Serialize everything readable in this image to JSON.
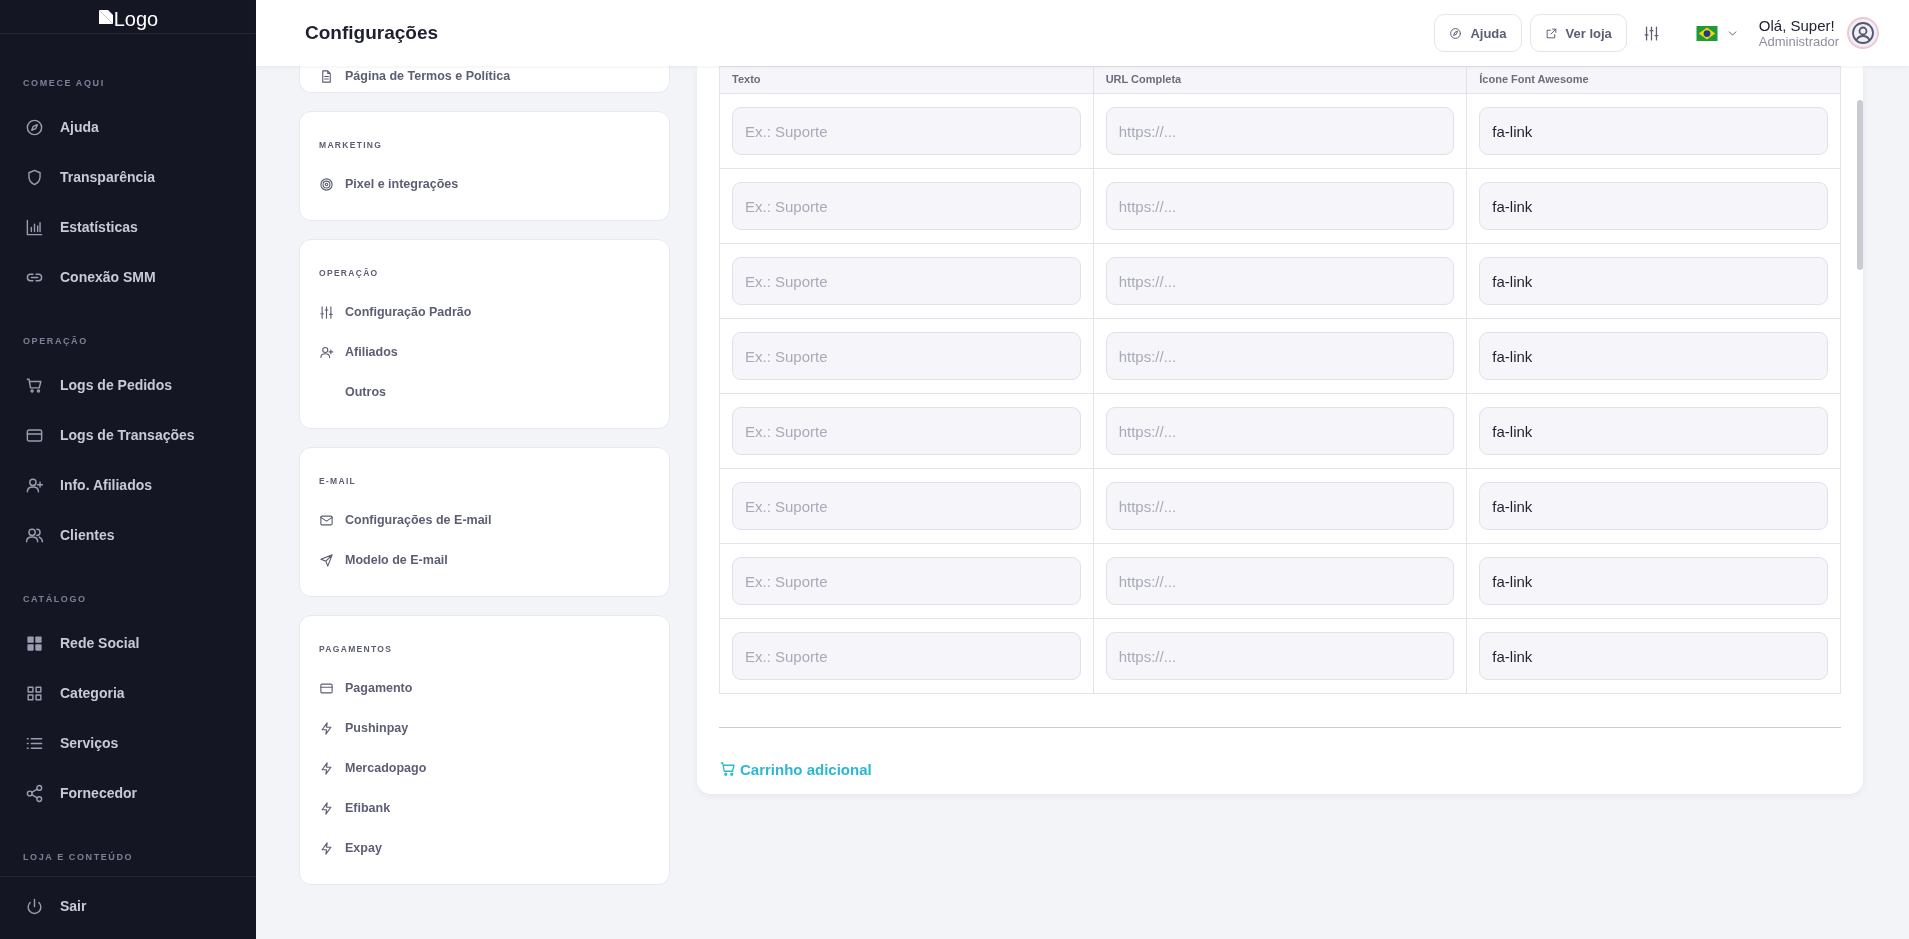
{
  "sidebar": {
    "logo": "Logo",
    "sections": [
      {
        "title": "COMECE AQUI",
        "items": [
          {
            "label": "Ajuda"
          },
          {
            "label": "Transparência"
          },
          {
            "label": "Estatísticas"
          },
          {
            "label": "Conexão SMM"
          }
        ]
      },
      {
        "title": "OPERAÇÃO",
        "items": [
          {
            "label": "Logs de Pedidos"
          },
          {
            "label": "Logs de Transações"
          },
          {
            "label": "Info. Afiliados"
          },
          {
            "label": "Clientes"
          }
        ]
      },
      {
        "title": "CATÁLOGO",
        "items": [
          {
            "label": "Rede Social"
          },
          {
            "label": "Categoria"
          },
          {
            "label": "Serviços"
          },
          {
            "label": "Fornecedor"
          }
        ]
      },
      {
        "title": "LOJA E CONTEÚDO"
      }
    ],
    "footer_item": {
      "label": "Sair"
    }
  },
  "header": {
    "title": "Configurações",
    "help_button": "Ajuda",
    "store_button": "Ver loja",
    "greeting": "Olá, Super!",
    "role": "Administrador"
  },
  "settings_menu": [
    {
      "items": [
        {
          "label": "Página de Termos e Política"
        }
      ]
    },
    {
      "title": "MARKETING",
      "items": [
        {
          "label": "Pixel e integrações"
        }
      ]
    },
    {
      "title": "OPERAÇÃO",
      "items": [
        {
          "label": "Configuração Padrão"
        },
        {
          "label": "Afiliados"
        },
        {
          "label": "Outros"
        }
      ]
    },
    {
      "title": "E-MAIL",
      "items": [
        {
          "label": "Configurações de E-mail"
        },
        {
          "label": "Modelo de E-mail"
        }
      ]
    },
    {
      "title": "PAGAMENTOS",
      "items": [
        {
          "label": "Pagamento"
        },
        {
          "label": "Pushinpay"
        },
        {
          "label": "Mercadopago"
        },
        {
          "label": "Efibank"
        },
        {
          "label": "Expay"
        }
      ]
    }
  ],
  "links_table": {
    "columns": [
      "Texto",
      "URL Completa",
      "Ícone Font Awesome"
    ],
    "rows": [
      {
        "text_placeholder": "Ex.: Suporte",
        "url_placeholder": "https://...",
        "icon": "fa-link"
      },
      {
        "text_placeholder": "Ex.: Suporte",
        "url_placeholder": "https://...",
        "icon": "fa-link"
      },
      {
        "text_placeholder": "Ex.: Suporte",
        "url_placeholder": "https://...",
        "icon": "fa-link"
      },
      {
        "text_placeholder": "Ex.: Suporte",
        "url_placeholder": "https://...",
        "icon": "fa-link"
      },
      {
        "text_placeholder": "Ex.: Suporte",
        "url_placeholder": "https://...",
        "icon": "fa-link"
      },
      {
        "text_placeholder": "Ex.: Suporte",
        "url_placeholder": "https://...",
        "icon": "fa-link"
      },
      {
        "text_placeholder": "Ex.: Suporte",
        "url_placeholder": "https://...",
        "icon": "fa-link"
      },
      {
        "text_placeholder": "Ex.: Suporte",
        "url_placeholder": "https://...",
        "icon": "fa-link"
      }
    ]
  },
  "extra_link": "Carrinho adicional"
}
